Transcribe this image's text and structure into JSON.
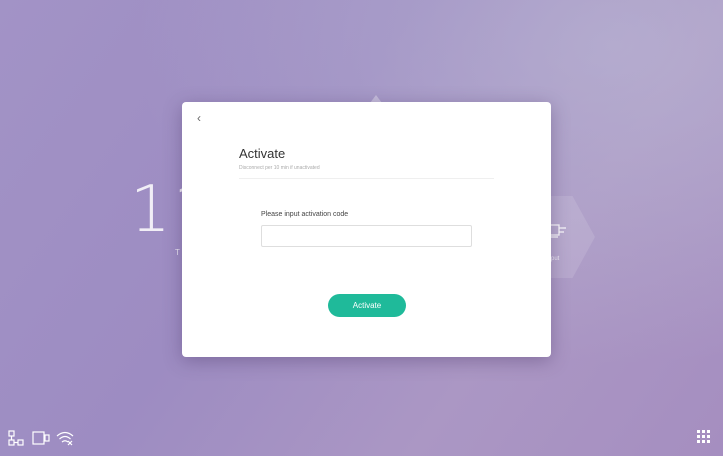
{
  "background": {
    "clock_fragment": "11",
    "clock_sub_fragment": "T",
    "input_label_fragment": "put",
    "icons": [
      "plug-icon"
    ]
  },
  "dialog": {
    "back_icon": "chevron-left-icon",
    "back_glyph": "‹",
    "title": "Activate",
    "subtitle": "Disconnect per 10 min if unactivated",
    "code_label": "Please input activation code",
    "code_value": "",
    "code_placeholder": "",
    "activate_button": "Activate",
    "accent_color": "#1fba9a"
  },
  "taskbar": {
    "left_icons": [
      "network-icon",
      "screen-share-icon",
      "wifi-icon"
    ],
    "right_icon": "apps-grid-icon"
  }
}
